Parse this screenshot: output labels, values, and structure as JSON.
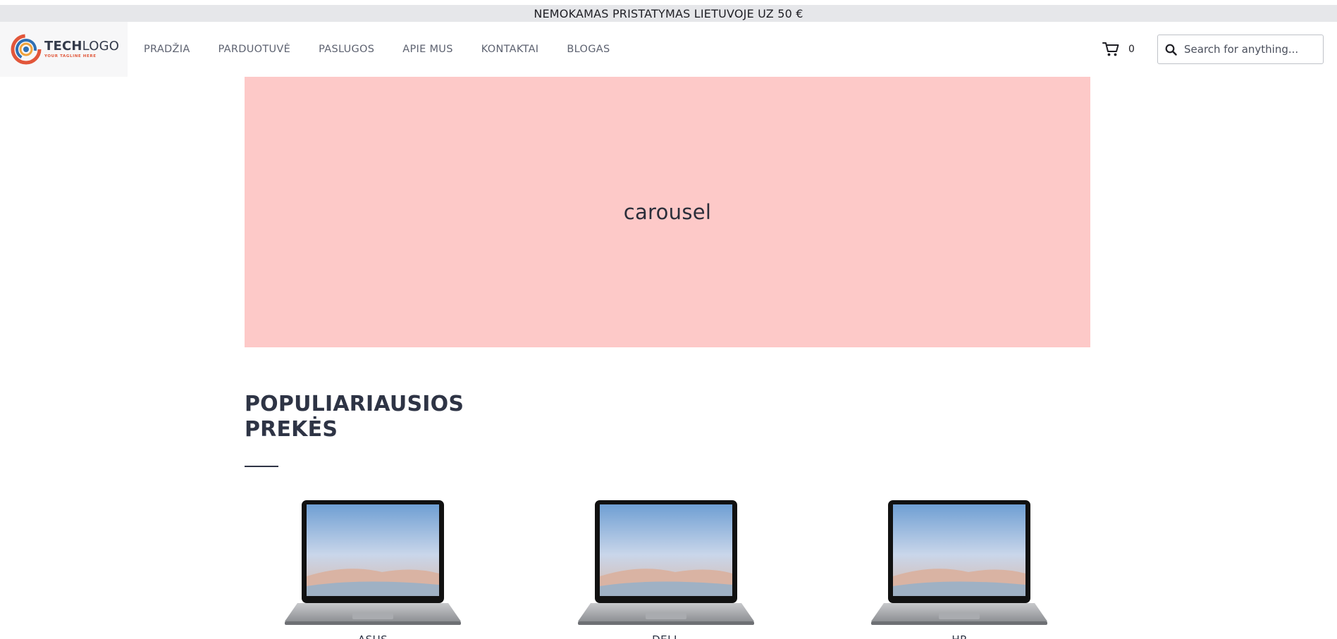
{
  "announcement": {
    "text": "NEMOKAMAS PRISTATYMAS LIETUVOJE UZ 50 €"
  },
  "logo": {
    "word_bold": "TECH",
    "word_light": "LOGO",
    "tagline": "YOUR TAGLINE HERE"
  },
  "nav": {
    "items": [
      {
        "label": "PRADŽIA"
      },
      {
        "label": "PARDUOTUVĖ"
      },
      {
        "label": "PASLUGOS"
      },
      {
        "label": "APIE MUS"
      },
      {
        "label": "KONTAKTAI"
      },
      {
        "label": "BLOGAS"
      }
    ]
  },
  "cart": {
    "count": "0",
    "icon": "cart-icon"
  },
  "search": {
    "placeholder": "Search for anything...",
    "icon": "search-icon"
  },
  "carousel": {
    "label": "carousel",
    "background": "#fdc9c8"
  },
  "section": {
    "title_line1": "POPULIARIAUSIOS",
    "title_line2": "PREKĖS"
  },
  "products": [
    {
      "name": "ASUS"
    },
    {
      "name": "DELL"
    },
    {
      "name": "HP"
    }
  ],
  "colors": {
    "announce_bg": "#e6e7ea",
    "logo_box_bg": "#f7f7f8",
    "text_dark": "#2e3445"
  }
}
